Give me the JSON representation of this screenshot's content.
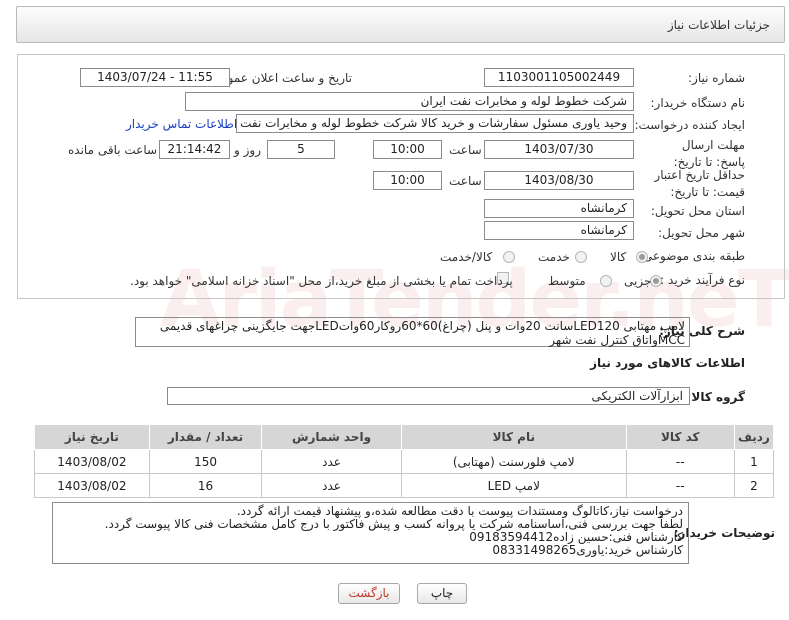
{
  "header": {
    "title": "جزئیات اطلاعات نیاز"
  },
  "form": {
    "need_number_label": "شماره نیاز:",
    "need_number": "1103001105002449",
    "announce_label": "تاریخ و ساعت اعلان عمومی:",
    "announce_value": "1403/07/24 - 11:55",
    "buyer_label": "نام دستگاه خریدار:",
    "buyer_value": "شرکت خطوط لوله و مخابرات نفت ایران",
    "creator_label": "ایجاد کننده درخواست:",
    "creator_value": "وحید یاوری مسئول سفارشات و خرید کالا  شرکت خطوط لوله و مخابرات نفت ایران",
    "contact_link": "اطلاعات تماس خریدار",
    "deadline_label": "مهلت ارسال پاسخ: تا تاریخ:",
    "deadline_date": "1403/07/30",
    "time_label": "ساعت",
    "deadline_time": "10:00",
    "days_value": "5",
    "days_label": "روز و",
    "remaining_time": "21:14:42",
    "remaining_label": "ساعت باقی مانده",
    "validity_label": "حداقل تاریخ اعتبار قیمت: تا تاریخ:",
    "validity_date": "1403/08/30",
    "validity_time": "10:00",
    "province_label": "استان محل تحویل:",
    "province_value": "کرمانشاه",
    "city_label": "شهر محل تحویل:",
    "city_value": "کرمانشاه",
    "category_label": "طبقه بندی موضوعی:",
    "category_options": [
      "کالا",
      "خدمت",
      "کالا/خدمت"
    ],
    "category_selected": "کالا",
    "process_label": "نوع فرآیند خرید :",
    "process_options": [
      "جزیی",
      "متوسط"
    ],
    "process_selected": "جزیی",
    "treasury_note": "پرداخت تمام یا بخشی از مبلغ خرید،از محل \"اسناد خزانه اسلامی\" خواهد بود."
  },
  "description": {
    "label": "شرح کلی نیاز:",
    "line1": "لامپ مهتابی LED120سانت 20وات و پنل (چراغ)60*60روکار60واتLEDجهت جایگزینی چراغهای قدیمی",
    "line2": "MCCواتاق کنترل نفت شهر"
  },
  "goods": {
    "section_title": "اطلاعات کالاهای مورد نیاز",
    "group_label": "گروه کالا:",
    "group_value": "ابزارآلات الکتریکی",
    "columns": [
      "ردیف",
      "کد کالا",
      "نام کالا",
      "واحد شمارش",
      "تعداد / مقدار",
      "تاریخ نیاز"
    ],
    "rows": [
      {
        "row": "1",
        "code": "--",
        "name": "لامپ فلورسنت (مهتابی)",
        "unit": "عدد",
        "qty": "150",
        "date": "1403/08/02"
      },
      {
        "row": "2",
        "code": "--",
        "name": "لامپ LED",
        "unit": "عدد",
        "qty": "16",
        "date": "1403/08/02"
      }
    ]
  },
  "buyer_notes": {
    "label": "توضیحات خریدار:",
    "lines": [
      "درخواست نیاز،کاتالوگ ومستندات پیوست با دقت مطالعه شده،و پیشنهاد قیمت ارائه گردد.",
      "لطفاً جهت بررسی فنی،اساسنامه شرکت یا پروانه کسب و پیش فاکتور با درج کامل مشخصات فنی کالا پیوست گردد.",
      "کارشناس فنی:حسین زاده09183594412",
      "کارشناس خرید:یاوری08331498265"
    ]
  },
  "actions": {
    "print": "چاپ",
    "back": "بازگشت"
  },
  "watermark": "AriaTender.neT"
}
